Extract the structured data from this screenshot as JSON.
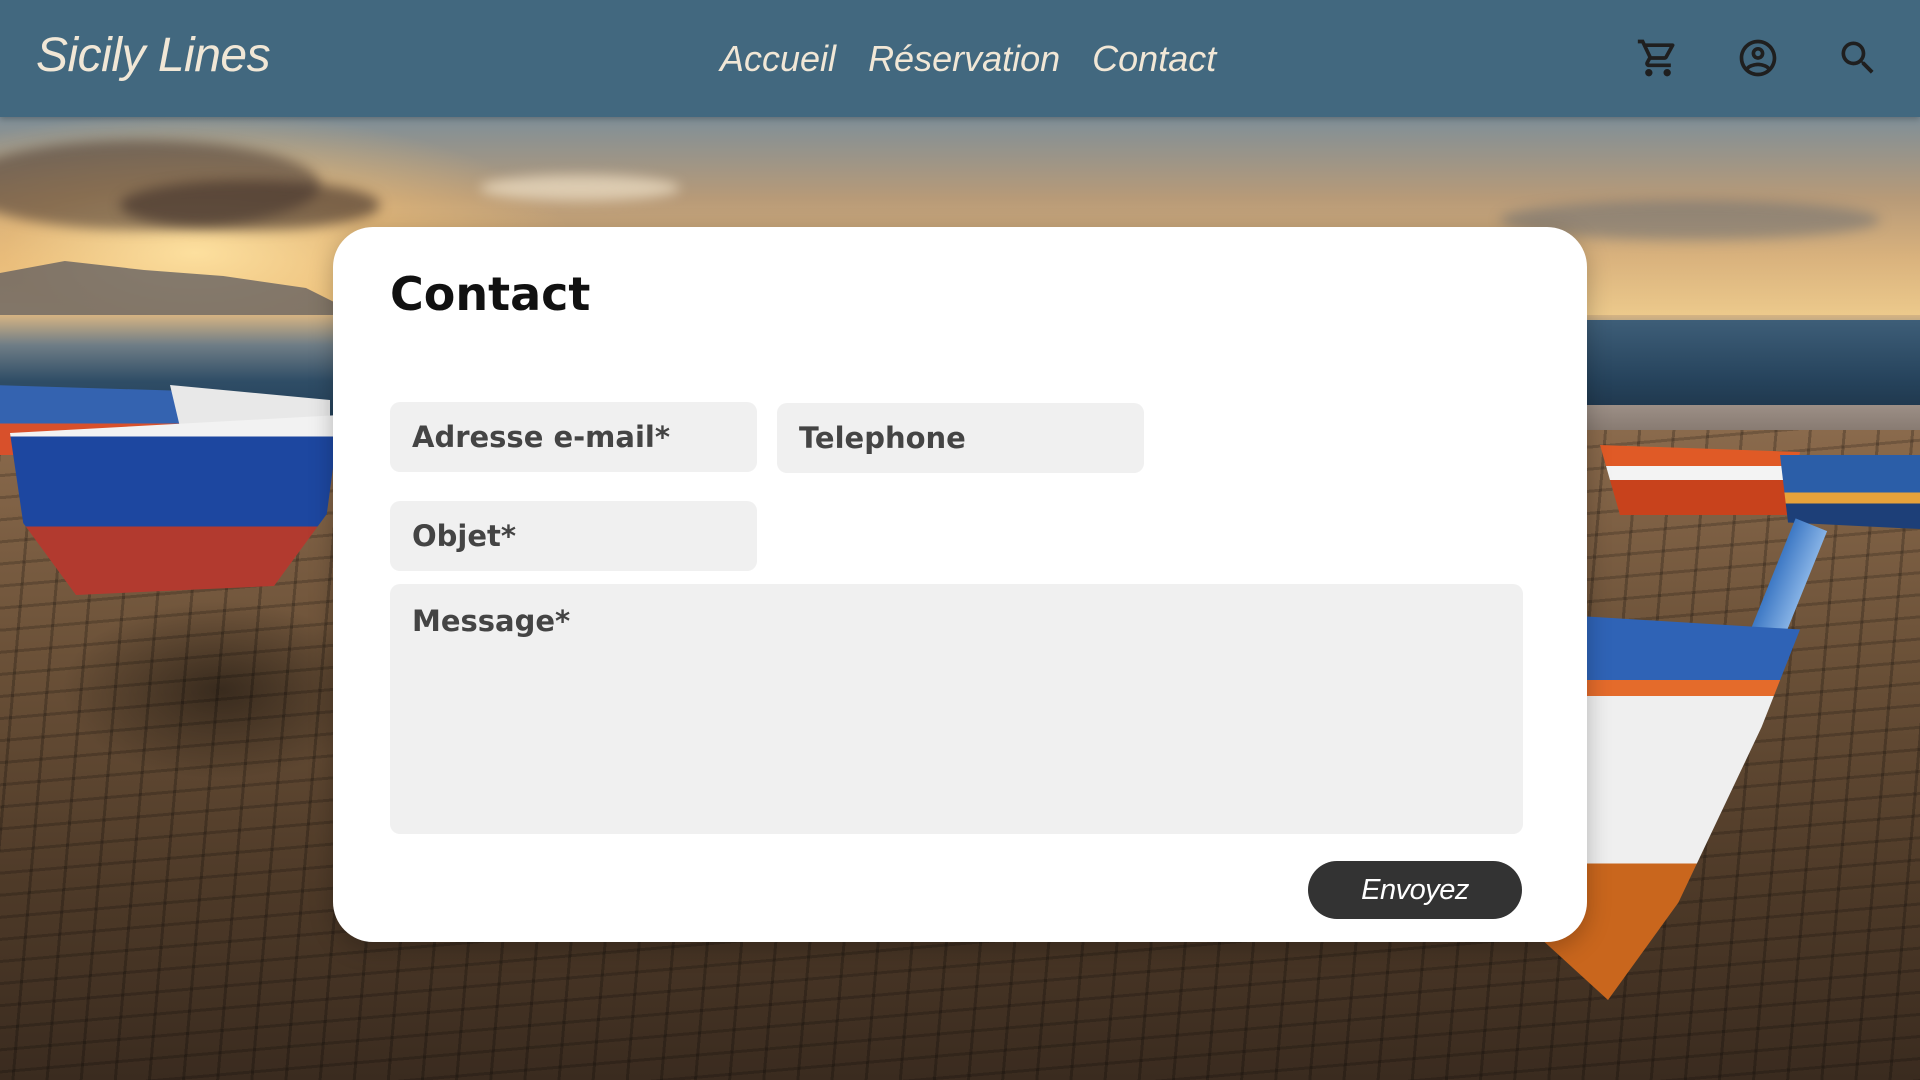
{
  "header": {
    "logo": "Sicily Lines",
    "nav": [
      {
        "label": "Accueil"
      },
      {
        "label": "Réservation"
      },
      {
        "label": "Contact"
      }
    ],
    "icons": [
      "cart-icon",
      "account-icon",
      "search-icon"
    ]
  },
  "contact_form": {
    "title": "Contact",
    "email_placeholder": "Adresse e-mail*",
    "phone_placeholder": "Telephone",
    "object_placeholder": "Objet*",
    "message_placeholder": "Message*",
    "submit_label": "Envoyez"
  },
  "colors": {
    "header_bg": "#42687f",
    "header_text": "#f1e7d6",
    "field_bg": "#f0f0f0",
    "button_bg": "#333333"
  }
}
